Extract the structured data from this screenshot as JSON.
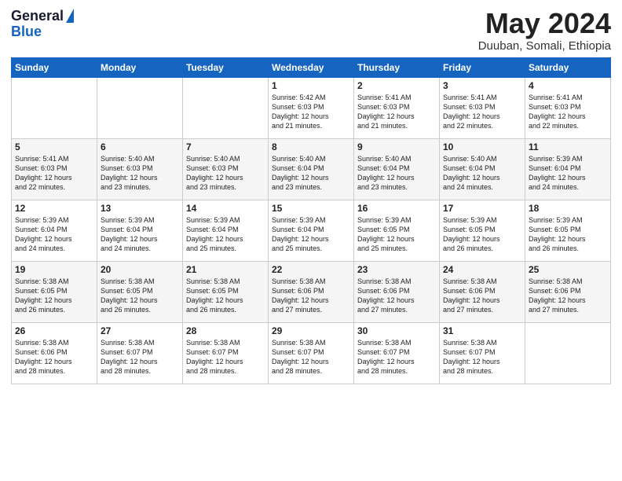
{
  "logo": {
    "line1": "General",
    "line2": "Blue"
  },
  "title": "May 2024",
  "location": "Duuban, Somali, Ethiopia",
  "weekdays": [
    "Sunday",
    "Monday",
    "Tuesday",
    "Wednesday",
    "Thursday",
    "Friday",
    "Saturday"
  ],
  "weeks": [
    [
      {
        "day": "",
        "info": ""
      },
      {
        "day": "",
        "info": ""
      },
      {
        "day": "",
        "info": ""
      },
      {
        "day": "1",
        "info": "Sunrise: 5:42 AM\nSunset: 6:03 PM\nDaylight: 12 hours\nand 21 minutes."
      },
      {
        "day": "2",
        "info": "Sunrise: 5:41 AM\nSunset: 6:03 PM\nDaylight: 12 hours\nand 21 minutes."
      },
      {
        "day": "3",
        "info": "Sunrise: 5:41 AM\nSunset: 6:03 PM\nDaylight: 12 hours\nand 22 minutes."
      },
      {
        "day": "4",
        "info": "Sunrise: 5:41 AM\nSunset: 6:03 PM\nDaylight: 12 hours\nand 22 minutes."
      }
    ],
    [
      {
        "day": "5",
        "info": "Sunrise: 5:41 AM\nSunset: 6:03 PM\nDaylight: 12 hours\nand 22 minutes."
      },
      {
        "day": "6",
        "info": "Sunrise: 5:40 AM\nSunset: 6:03 PM\nDaylight: 12 hours\nand 23 minutes."
      },
      {
        "day": "7",
        "info": "Sunrise: 5:40 AM\nSunset: 6:03 PM\nDaylight: 12 hours\nand 23 minutes."
      },
      {
        "day": "8",
        "info": "Sunrise: 5:40 AM\nSunset: 6:04 PM\nDaylight: 12 hours\nand 23 minutes."
      },
      {
        "day": "9",
        "info": "Sunrise: 5:40 AM\nSunset: 6:04 PM\nDaylight: 12 hours\nand 23 minutes."
      },
      {
        "day": "10",
        "info": "Sunrise: 5:40 AM\nSunset: 6:04 PM\nDaylight: 12 hours\nand 24 minutes."
      },
      {
        "day": "11",
        "info": "Sunrise: 5:39 AM\nSunset: 6:04 PM\nDaylight: 12 hours\nand 24 minutes."
      }
    ],
    [
      {
        "day": "12",
        "info": "Sunrise: 5:39 AM\nSunset: 6:04 PM\nDaylight: 12 hours\nand 24 minutes."
      },
      {
        "day": "13",
        "info": "Sunrise: 5:39 AM\nSunset: 6:04 PM\nDaylight: 12 hours\nand 24 minutes."
      },
      {
        "day": "14",
        "info": "Sunrise: 5:39 AM\nSunset: 6:04 PM\nDaylight: 12 hours\nand 25 minutes."
      },
      {
        "day": "15",
        "info": "Sunrise: 5:39 AM\nSunset: 6:04 PM\nDaylight: 12 hours\nand 25 minutes."
      },
      {
        "day": "16",
        "info": "Sunrise: 5:39 AM\nSunset: 6:05 PM\nDaylight: 12 hours\nand 25 minutes."
      },
      {
        "day": "17",
        "info": "Sunrise: 5:39 AM\nSunset: 6:05 PM\nDaylight: 12 hours\nand 26 minutes."
      },
      {
        "day": "18",
        "info": "Sunrise: 5:39 AM\nSunset: 6:05 PM\nDaylight: 12 hours\nand 26 minutes."
      }
    ],
    [
      {
        "day": "19",
        "info": "Sunrise: 5:38 AM\nSunset: 6:05 PM\nDaylight: 12 hours\nand 26 minutes."
      },
      {
        "day": "20",
        "info": "Sunrise: 5:38 AM\nSunset: 6:05 PM\nDaylight: 12 hours\nand 26 minutes."
      },
      {
        "day": "21",
        "info": "Sunrise: 5:38 AM\nSunset: 6:05 PM\nDaylight: 12 hours\nand 26 minutes."
      },
      {
        "day": "22",
        "info": "Sunrise: 5:38 AM\nSunset: 6:06 PM\nDaylight: 12 hours\nand 27 minutes."
      },
      {
        "day": "23",
        "info": "Sunrise: 5:38 AM\nSunset: 6:06 PM\nDaylight: 12 hours\nand 27 minutes."
      },
      {
        "day": "24",
        "info": "Sunrise: 5:38 AM\nSunset: 6:06 PM\nDaylight: 12 hours\nand 27 minutes."
      },
      {
        "day": "25",
        "info": "Sunrise: 5:38 AM\nSunset: 6:06 PM\nDaylight: 12 hours\nand 27 minutes."
      }
    ],
    [
      {
        "day": "26",
        "info": "Sunrise: 5:38 AM\nSunset: 6:06 PM\nDaylight: 12 hours\nand 28 minutes."
      },
      {
        "day": "27",
        "info": "Sunrise: 5:38 AM\nSunset: 6:07 PM\nDaylight: 12 hours\nand 28 minutes."
      },
      {
        "day": "28",
        "info": "Sunrise: 5:38 AM\nSunset: 6:07 PM\nDaylight: 12 hours\nand 28 minutes."
      },
      {
        "day": "29",
        "info": "Sunrise: 5:38 AM\nSunset: 6:07 PM\nDaylight: 12 hours\nand 28 minutes."
      },
      {
        "day": "30",
        "info": "Sunrise: 5:38 AM\nSunset: 6:07 PM\nDaylight: 12 hours\nand 28 minutes."
      },
      {
        "day": "31",
        "info": "Sunrise: 5:38 AM\nSunset: 6:07 PM\nDaylight: 12 hours\nand 28 minutes."
      },
      {
        "day": "",
        "info": ""
      }
    ]
  ]
}
